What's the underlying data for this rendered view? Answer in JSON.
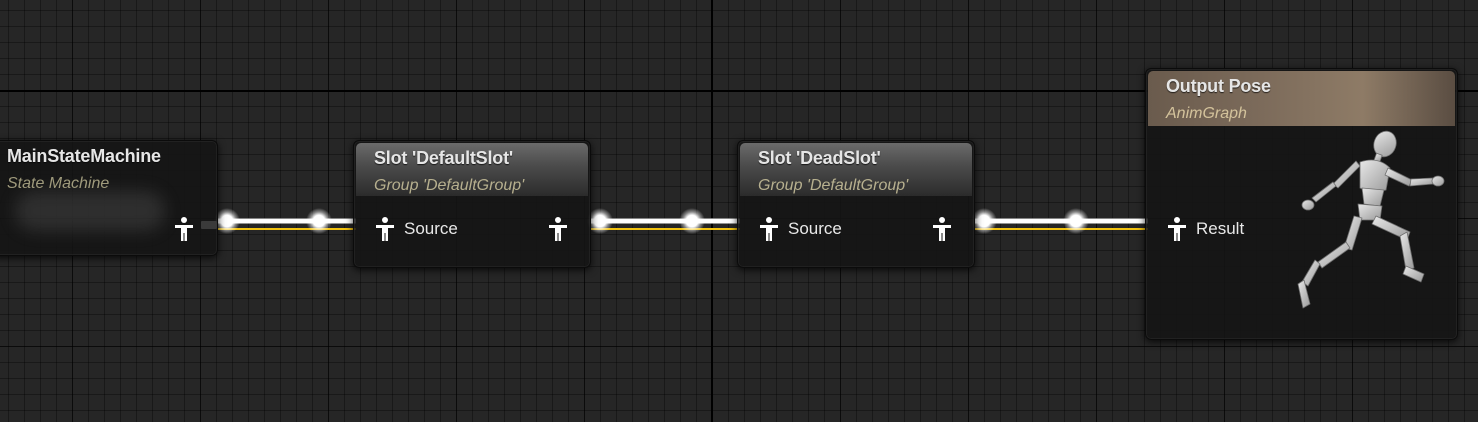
{
  "graph": {
    "nodes": [
      {
        "id": "main_state_machine",
        "title": "MainStateMachine",
        "subtitle": "State Machine"
      },
      {
        "id": "slot_default",
        "title": "Slot 'DefaultSlot'",
        "subtitle": "Group 'DefaultGroup'",
        "input_label": "Source"
      },
      {
        "id": "slot_dead",
        "title": "Slot 'DeadSlot'",
        "subtitle": "Group 'DefaultGroup'",
        "input_label": "Source"
      },
      {
        "id": "output_pose",
        "title": "Output Pose",
        "subtitle": "AnimGraph",
        "input_label": "Result"
      }
    ],
    "colors": {
      "canvas_bg": "#262626",
      "wire_white": "#ffffff",
      "wire_yellow": "#f2c20f",
      "output_header": "#8e7b66",
      "slot_header": "#5a5a5a"
    },
    "icons": {
      "pose_pin": "pose-person-icon",
      "preview": "mannequin-running-icon"
    }
  }
}
